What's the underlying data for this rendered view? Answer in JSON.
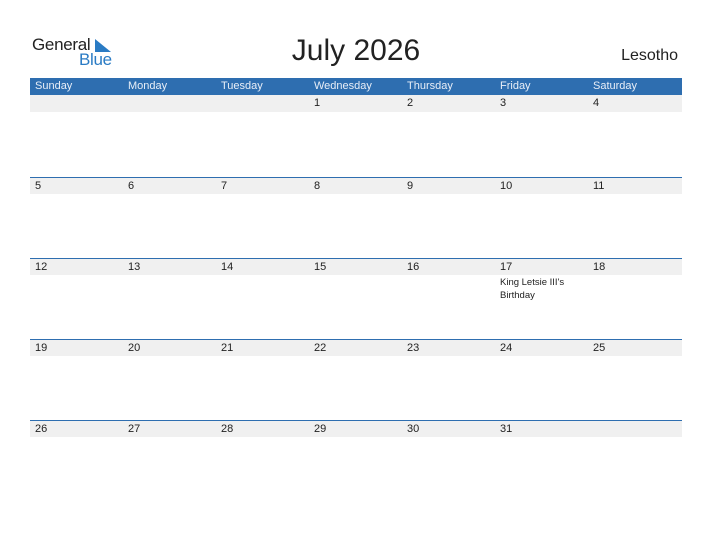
{
  "logo": {
    "line1": "General",
    "line2": "Blue",
    "icon": "triangle-flag-icon"
  },
  "title": "July 2026",
  "country": "Lesotho",
  "colors": {
    "header": "#2e6eb0",
    "brand_blue": "#2a7bc4",
    "date_strip": "#f0f0f0"
  },
  "weekdays": [
    "Sunday",
    "Monday",
    "Tuesday",
    "Wednesday",
    "Thursday",
    "Friday",
    "Saturday"
  ],
  "weeks": [
    [
      {
        "day": ""
      },
      {
        "day": ""
      },
      {
        "day": ""
      },
      {
        "day": "1"
      },
      {
        "day": "2"
      },
      {
        "day": "3"
      },
      {
        "day": "4"
      }
    ],
    [
      {
        "day": "5"
      },
      {
        "day": "6"
      },
      {
        "day": "7"
      },
      {
        "day": "8"
      },
      {
        "day": "9"
      },
      {
        "day": "10"
      },
      {
        "day": "11"
      }
    ],
    [
      {
        "day": "12"
      },
      {
        "day": "13"
      },
      {
        "day": "14"
      },
      {
        "day": "15"
      },
      {
        "day": "16"
      },
      {
        "day": "17",
        "event": "King Letsie III's Birthday"
      },
      {
        "day": "18"
      }
    ],
    [
      {
        "day": "19"
      },
      {
        "day": "20"
      },
      {
        "day": "21"
      },
      {
        "day": "22"
      },
      {
        "day": "23"
      },
      {
        "day": "24"
      },
      {
        "day": "25"
      }
    ],
    [
      {
        "day": "26"
      },
      {
        "day": "27"
      },
      {
        "day": "28"
      },
      {
        "day": "29"
      },
      {
        "day": "30"
      },
      {
        "day": "31"
      },
      {
        "day": ""
      }
    ]
  ]
}
